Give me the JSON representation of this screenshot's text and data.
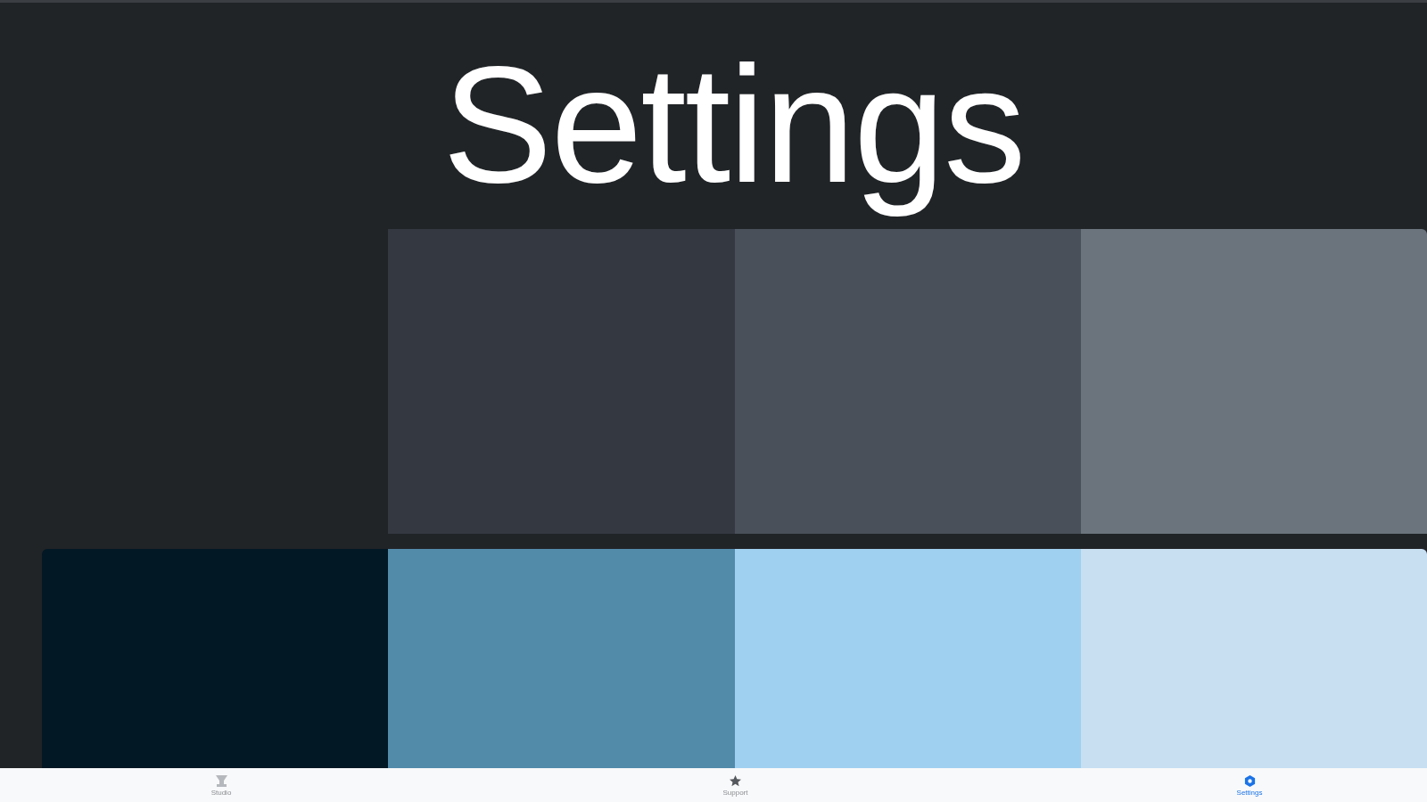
{
  "title": "Settings",
  "palettes": [
    {
      "swatches": [
        {
          "color": "#343841"
        },
        {
          "color": "#4a5059"
        },
        {
          "color": "#6b747d"
        }
      ]
    },
    {
      "swatches": [
        {
          "color": "#021824"
        },
        {
          "color": "#528aaa"
        },
        {
          "color": "#9fd0f0"
        },
        {
          "color": "#c8dff2"
        }
      ]
    }
  ],
  "bottom_nav": [
    {
      "label": "Studio",
      "selected": false
    },
    {
      "label": "Support",
      "selected": false
    },
    {
      "label": "Settings",
      "selected": true
    }
  ]
}
